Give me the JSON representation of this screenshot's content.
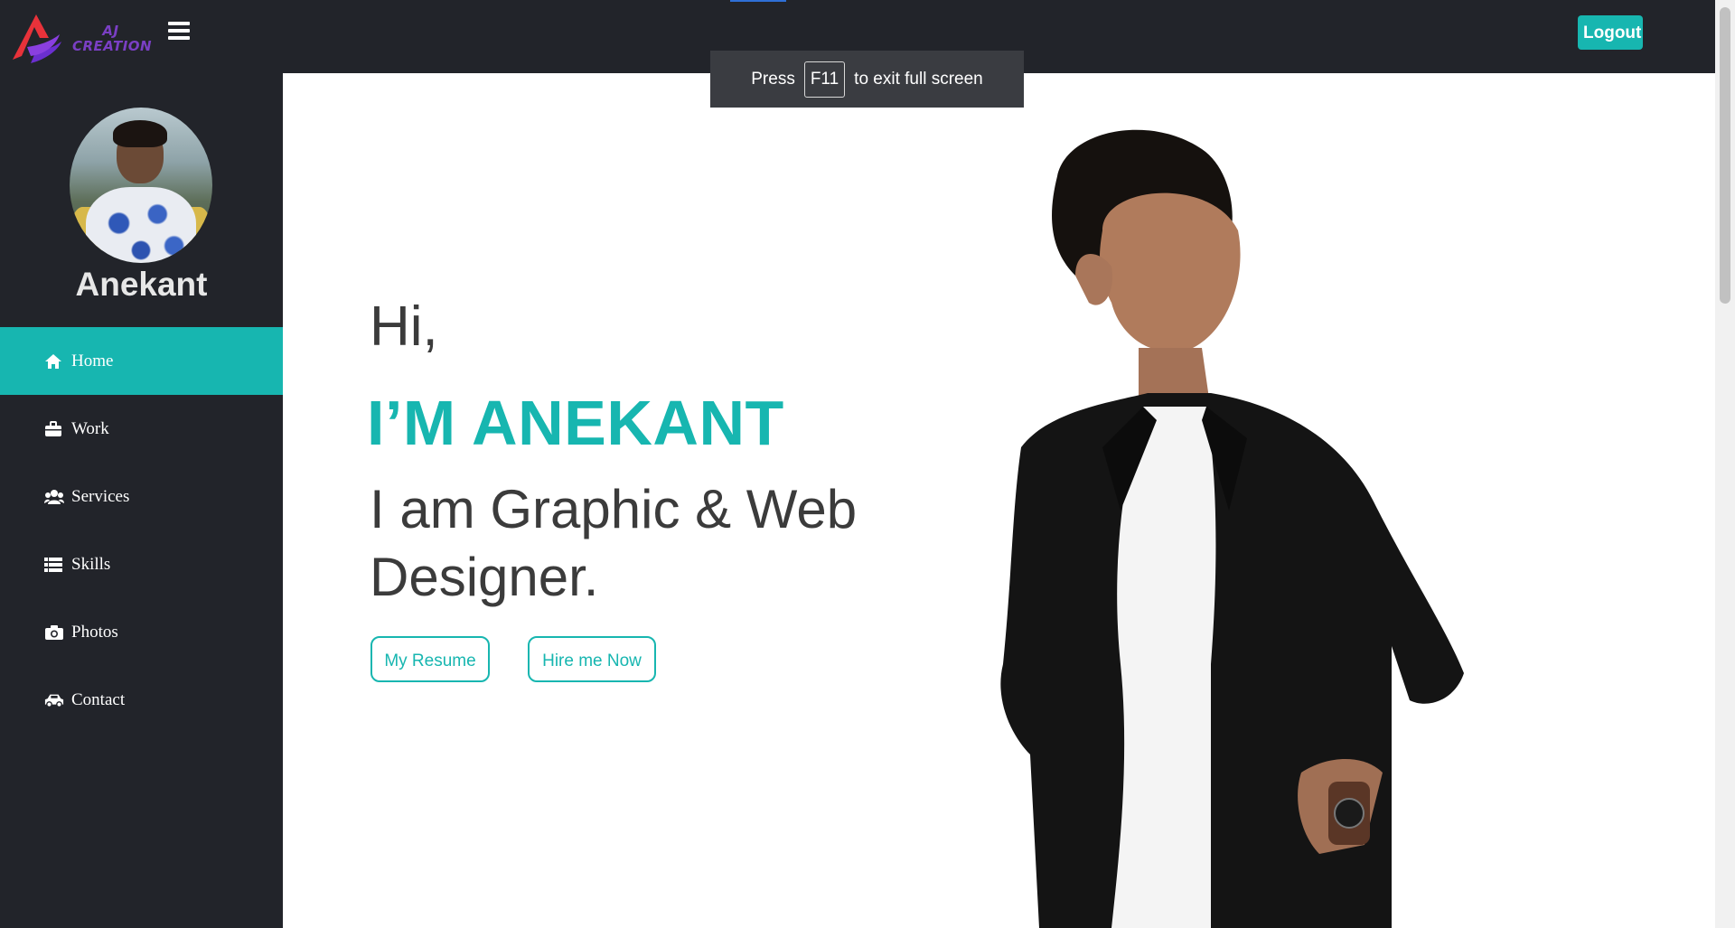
{
  "brand": {
    "line1": "AJ",
    "line2": "CREATION"
  },
  "header": {
    "logout_label": "Logout"
  },
  "sidebar": {
    "name": "Anekant",
    "items": [
      {
        "label": "Home",
        "icon": "home-icon",
        "active": true
      },
      {
        "label": "Work",
        "icon": "briefcase-icon",
        "active": false
      },
      {
        "label": "Services",
        "icon": "users-icon",
        "active": false
      },
      {
        "label": "Skills",
        "icon": "list-icon",
        "active": false
      },
      {
        "label": "Photos",
        "icon": "camera-icon",
        "active": false
      },
      {
        "label": "Contact",
        "icon": "car-icon",
        "active": false
      }
    ]
  },
  "hero": {
    "greeting": "Hi,",
    "name": "I’M ANEKANT",
    "role": "I am Graphic & Web Designer.",
    "resume_label": "My Resume",
    "hire_label": "Hire me Now"
  },
  "fullscreen_notice": {
    "press": "Press",
    "key": "F11",
    "rest": "to exit full screen"
  },
  "colors": {
    "accent": "#17b6b0",
    "dark": "#22242a",
    "text": "#3b3b3b"
  }
}
